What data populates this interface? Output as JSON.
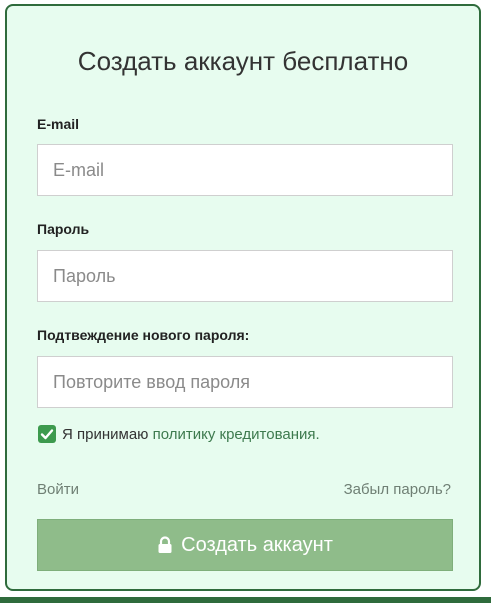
{
  "form": {
    "title": "Создать аккаунт бесплатно",
    "email": {
      "label": "E-mail",
      "placeholder": "E-mail"
    },
    "password": {
      "label": "Пароль",
      "placeholder": "Пароль"
    },
    "confirm": {
      "label": "Подтвеждение нового пароля:",
      "placeholder": "Повторите ввод пароля"
    },
    "accept": {
      "checked": true,
      "text": "Я принимаю ",
      "link_text": "политику кредитования."
    },
    "login_link": "Войти",
    "forgot_link": "Забыл пароль?",
    "submit_label": "Создать аккаунт",
    "submit_icon": "lock-icon"
  },
  "colors": {
    "card_background": "#e7fcef",
    "border": "#2f6b3c",
    "button": "#8fbc8a",
    "checkbox": "#3d9a4e"
  }
}
